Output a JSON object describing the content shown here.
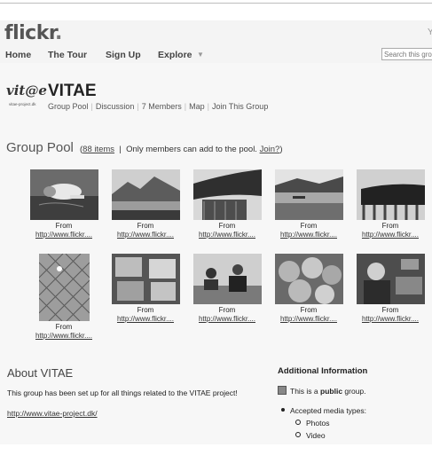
{
  "header": {
    "logo": "flickr",
    "corner_letter": "Y",
    "nav": [
      "Home",
      "The Tour",
      "Sign Up",
      "Explore"
    ],
    "search_placeholder": "Search this gro"
  },
  "group": {
    "logo_mark": "vit@e",
    "logo_sub": "vitae-project.dk",
    "title": "VITAE",
    "nav": [
      "Group Pool",
      "Discussion",
      "7 Members",
      "Map",
      "Join This Group"
    ]
  },
  "pool": {
    "title": "Group Pool",
    "items_link": "88 items",
    "note": "Only members can add to the pool.",
    "join": "Join?",
    "photos": [
      {
        "icon": "photo-dog",
        "from": "From",
        "url": "http://www.flickr...."
      },
      {
        "icon": "photo-lake-mountains",
        "from": "From",
        "url": "http://www.flickr...."
      },
      {
        "icon": "photo-pagoda-roof",
        "from": "From",
        "url": "http://www.flickr...."
      },
      {
        "icon": "photo-river-boats",
        "from": "From",
        "url": "http://www.flickr...."
      },
      {
        "icon": "photo-roof-dragon",
        "from": "From",
        "url": "http://www.flickr...."
      },
      {
        "icon": "photo-chainlink-fence",
        "from": "From",
        "url": "http://www.flickr...."
      },
      {
        "icon": "photo-glass-cubes",
        "from": "From",
        "url": "http://www.flickr...."
      },
      {
        "icon": "photo-meeting-room",
        "from": "From",
        "url": "http://www.flickr...."
      },
      {
        "icon": "photo-apples",
        "from": "From",
        "url": "http://www.flickr...."
      },
      {
        "icon": "photo-woman-laptop",
        "from": "From",
        "url": "http://www.flickr...."
      }
    ]
  },
  "about": {
    "title": "About VITAE",
    "text": "This group has been set up for all things related to the VITAE project!",
    "link": "http://www.vitae-project.dk/"
  },
  "info": {
    "title": "Additional Information",
    "public_prefix": "This is a ",
    "public_bold": "public",
    "public_suffix": " group.",
    "media_label": "Accepted media types:",
    "media": [
      "Photos",
      "Video"
    ]
  }
}
